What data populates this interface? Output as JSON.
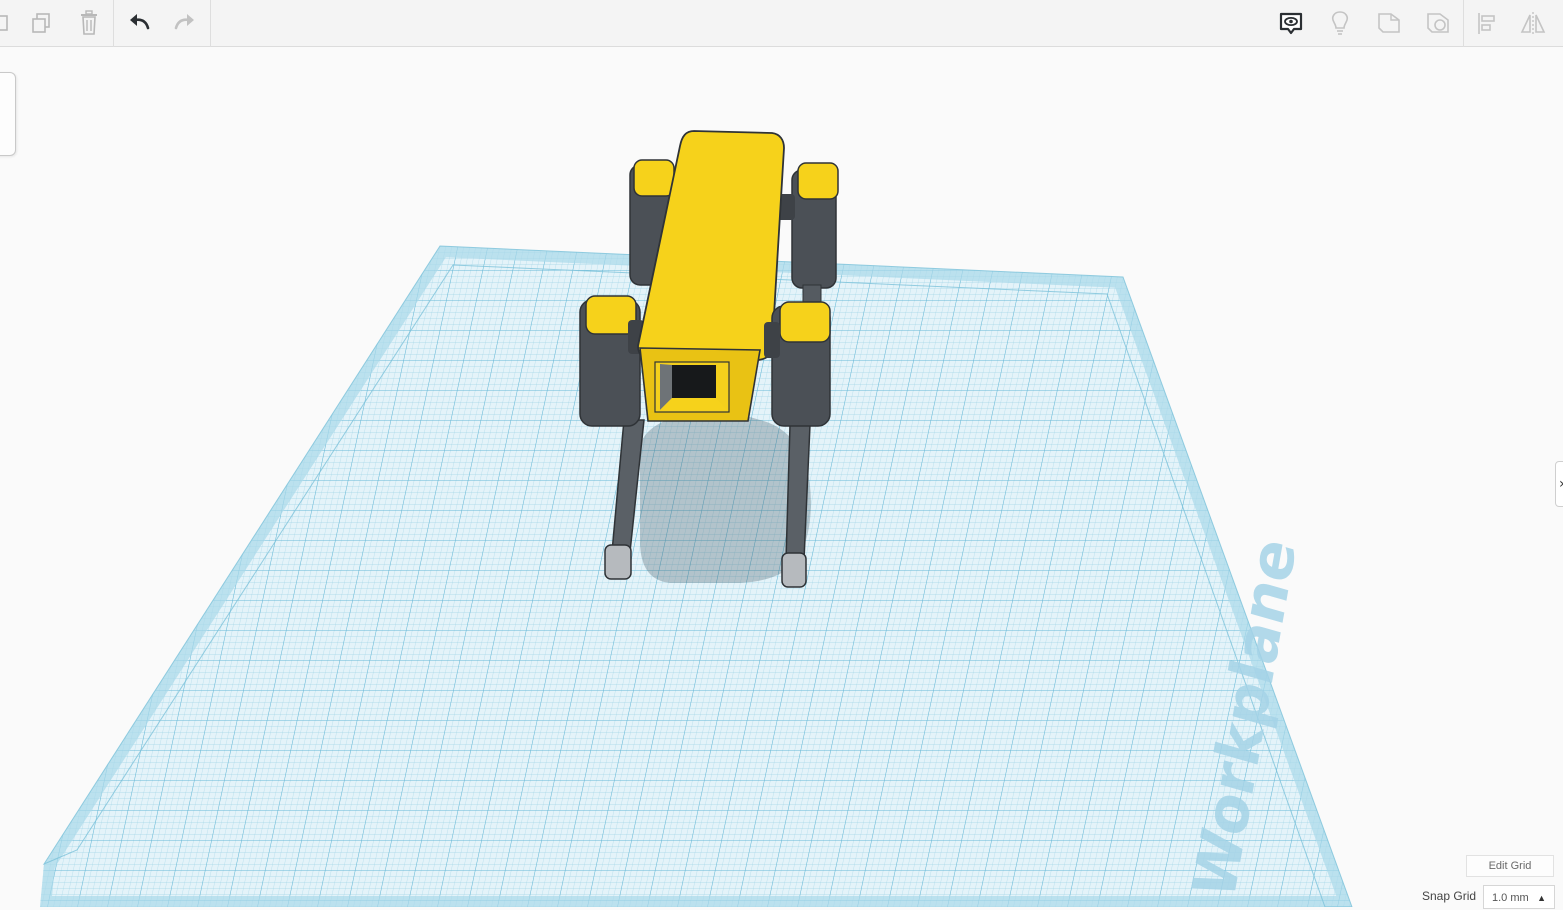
{
  "toolbar": {
    "left_tools": [
      "copy-icon",
      "duplicate-icon",
      "delete-icon",
      "undo-icon",
      "redo-icon"
    ],
    "right_tools": [
      "notes-icon",
      "light-icon",
      "shape-icon",
      "hole-icon",
      "align-icon",
      "mirror-icon"
    ]
  },
  "workplane": {
    "label": "Workplane",
    "grid_color": "#7fc6df",
    "fill_color": "#e7f5fa"
  },
  "model": {
    "body_color": "#f6d21b",
    "leg_color": "#4a4f54",
    "foot_color": "#9aa0a5"
  },
  "grid_controls": {
    "edit_grid_label": "Edit Grid",
    "snap_grid_label": "Snap Grid",
    "snap_grid_value": "1.0 mm"
  },
  "panel_handle": {
    "label": "›"
  }
}
